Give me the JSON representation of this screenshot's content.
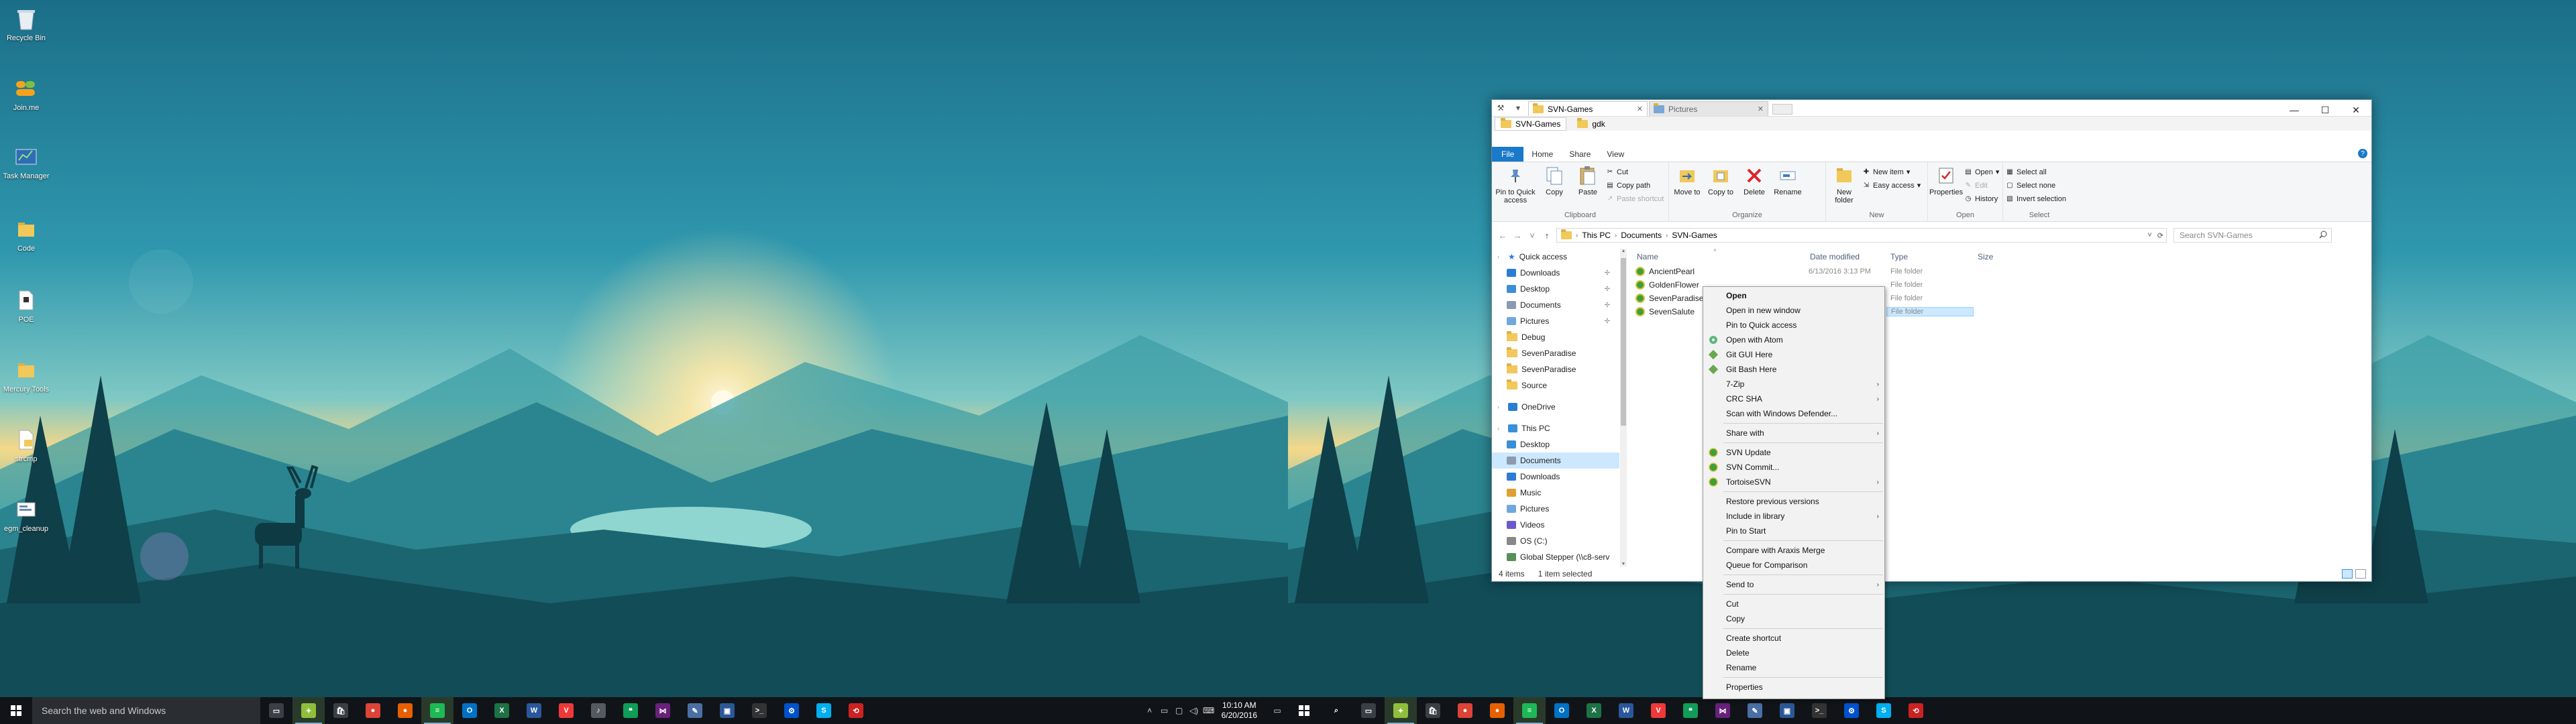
{
  "desktop": {
    "icons": [
      {
        "label": "Recycle Bin",
        "icon": "recycle-bin-icon"
      },
      {
        "label": "Join.me",
        "icon": "joinme-icon"
      },
      {
        "label": "Task Manager",
        "icon": "task-manager-icon"
      },
      {
        "label": "Code",
        "icon": "folder-icon"
      },
      {
        "label": "POE",
        "icon": "document-icon"
      },
      {
        "label": "Mercury Tools",
        "icon": "folder-icon"
      },
      {
        "label": "strcmp",
        "icon": "file-icon"
      },
      {
        "label": "egm_cleanup",
        "icon": "script-icon"
      }
    ]
  },
  "taskbar_left": {
    "search_placeholder": "Search the web and Windows",
    "time": "10:10 AM",
    "date": "6/20/2016",
    "apps": [
      {
        "name": "task-view",
        "color": "#3a3f45",
        "glyph": "▭",
        "active": false
      },
      {
        "name": "git-gui",
        "color": "#8fbf3a",
        "glyph": "✦",
        "active": true
      },
      {
        "name": "store",
        "color": "#3a3f45",
        "glyph": "🛍",
        "active": false
      },
      {
        "name": "chrome",
        "color": "#db4437",
        "glyph": "●",
        "active": false
      },
      {
        "name": "firefox",
        "color": "#e66000",
        "glyph": "●",
        "active": false
      },
      {
        "name": "spotify",
        "color": "#1db954",
        "glyph": "≡",
        "active": true
      },
      {
        "name": "outlook",
        "color": "#0072c6",
        "glyph": "O",
        "active": false
      },
      {
        "name": "excel",
        "color": "#1e7145",
        "glyph": "X",
        "active": false
      },
      {
        "name": "word",
        "color": "#2b579a",
        "glyph": "W",
        "active": false
      },
      {
        "name": "vivaldi",
        "color": "#ef3939",
        "glyph": "V",
        "active": false
      },
      {
        "name": "media",
        "color": "#555a60",
        "glyph": "♪",
        "active": false
      },
      {
        "name": "hangouts",
        "color": "#0f9d58",
        "glyph": "❝",
        "active": false
      },
      {
        "name": "visual-studio",
        "color": "#68217a",
        "glyph": "⋈",
        "active": false
      },
      {
        "name": "tools",
        "color": "#4a6fa5",
        "glyph": "✎",
        "active": false
      },
      {
        "name": "remote",
        "color": "#2b5797",
        "glyph": "▣",
        "active": false
      },
      {
        "name": "terminal",
        "color": "#333",
        "glyph": ">_",
        "active": false
      },
      {
        "name": "sourcetree",
        "color": "#0052cc",
        "glyph": "⚙",
        "active": false
      },
      {
        "name": "skype",
        "color": "#00aff0",
        "glyph": "S",
        "active": false
      },
      {
        "name": "tortoise",
        "color": "#cc2222",
        "glyph": "⟲",
        "active": false
      }
    ]
  },
  "taskbar_right": {
    "apps": [
      {
        "name": "search",
        "color": "#101418",
        "glyph": "⌕",
        "active": false
      },
      {
        "name": "task-view",
        "color": "#3a3f45",
        "glyph": "▭",
        "active": false
      },
      {
        "name": "git-gui",
        "color": "#8fbf3a",
        "glyph": "✦",
        "active": true
      },
      {
        "name": "store",
        "color": "#3a3f45",
        "glyph": "🛍",
        "active": false
      },
      {
        "name": "chrome",
        "color": "#db4437",
        "glyph": "●",
        "active": false
      },
      {
        "name": "firefox",
        "color": "#e66000",
        "glyph": "●",
        "active": false
      },
      {
        "name": "spotify",
        "color": "#1db954",
        "glyph": "≡",
        "active": true
      },
      {
        "name": "outlook",
        "color": "#0072c6",
        "glyph": "O",
        "active": false
      },
      {
        "name": "excel",
        "color": "#1e7145",
        "glyph": "X",
        "active": false
      },
      {
        "name": "word",
        "color": "#2b579a",
        "glyph": "W",
        "active": false
      },
      {
        "name": "vivaldi",
        "color": "#ef3939",
        "glyph": "V",
        "active": false
      },
      {
        "name": "hangouts",
        "color": "#0f9d58",
        "glyph": "❝",
        "active": false
      },
      {
        "name": "visual-studio",
        "color": "#68217a",
        "glyph": "⋈",
        "active": false
      },
      {
        "name": "tools",
        "color": "#4a6fa5",
        "glyph": "✎",
        "active": false
      },
      {
        "name": "remote",
        "color": "#2b5797",
        "glyph": "▣",
        "active": false
      },
      {
        "name": "terminal",
        "color": "#333",
        "glyph": ">_",
        "active": false
      },
      {
        "name": "sourcetree",
        "color": "#0052cc",
        "glyph": "⚙",
        "active": false
      },
      {
        "name": "skype",
        "color": "#00aff0",
        "glyph": "S",
        "active": false
      },
      {
        "name": "tortoise",
        "color": "#cc2222",
        "glyph": "⟲",
        "active": false
      }
    ]
  },
  "explorer": {
    "tabs": [
      {
        "label": "SVN-Games",
        "active": true
      },
      {
        "label": "Pictures",
        "active": false
      }
    ],
    "subtabs": [
      {
        "label": "SVN-Games",
        "active": true
      },
      {
        "label": "gdk",
        "active": false
      }
    ],
    "ribbon_tabs": {
      "file": "File",
      "home": "Home",
      "share": "Share",
      "view": "View"
    },
    "ribbon": {
      "clipboard": {
        "pin": "Pin to Quick access",
        "copy": "Copy",
        "paste": "Paste",
        "cut": "Cut",
        "copy_path": "Copy path",
        "paste_shortcut": "Paste shortcut",
        "group": "Clipboard"
      },
      "organize": {
        "move_to": "Move to",
        "copy_to": "Copy to",
        "delete": "Delete",
        "rename": "Rename",
        "group": "Organize"
      },
      "new": {
        "new_folder": "New folder",
        "new_item": "New item",
        "easy_access": "Easy access",
        "group": "New"
      },
      "open": {
        "properties": "Properties",
        "open": "Open",
        "edit": "Edit",
        "history": "History",
        "group": "Open"
      },
      "select": {
        "select_all": "Select all",
        "select_none": "Select none",
        "invert": "Invert selection",
        "group": "Select"
      }
    },
    "breadcrumb": [
      "This PC",
      "Documents",
      "SVN-Games"
    ],
    "search_placeholder": "Search SVN-Games",
    "nav": [
      {
        "label": "Quick access",
        "type": "star",
        "indent": 0,
        "pinned": false,
        "selected": false
      },
      {
        "label": "Downloads",
        "type": "download",
        "indent": 1,
        "pinned": true,
        "selected": false
      },
      {
        "label": "Desktop",
        "type": "desktop",
        "indent": 1,
        "pinned": true,
        "selected": false
      },
      {
        "label": "Documents",
        "type": "doc",
        "indent": 1,
        "pinned": true,
        "selected": false
      },
      {
        "label": "Pictures",
        "type": "pic",
        "indent": 1,
        "pinned": true,
        "selected": false
      },
      {
        "label": "Debug",
        "type": "folder",
        "indent": 1,
        "pinned": false,
        "selected": false
      },
      {
        "label": "SevenParadise",
        "type": "folder",
        "indent": 1,
        "pinned": false,
        "selected": false
      },
      {
        "label": "SevenParadise",
        "type": "folder",
        "indent": 1,
        "pinned": false,
        "selected": false
      },
      {
        "label": "Source",
        "type": "folder",
        "indent": 1,
        "pinned": false,
        "selected": false
      },
      {
        "label": "",
        "type": "spacer",
        "indent": 0,
        "pinned": false,
        "selected": false
      },
      {
        "label": "OneDrive",
        "type": "cloud",
        "indent": 0,
        "pinned": false,
        "selected": false
      },
      {
        "label": "",
        "type": "spacer",
        "indent": 0,
        "pinned": false,
        "selected": false
      },
      {
        "label": "This PC",
        "type": "pc",
        "indent": 0,
        "pinned": false,
        "selected": false
      },
      {
        "label": "Desktop",
        "type": "desktop",
        "indent": 1,
        "pinned": false,
        "selected": false
      },
      {
        "label": "Documents",
        "type": "doc",
        "indent": 1,
        "pinned": false,
        "selected": true
      },
      {
        "label": "Downloads",
        "type": "download",
        "indent": 1,
        "pinned": false,
        "selected": false
      },
      {
        "label": "Music",
        "type": "music",
        "indent": 1,
        "pinned": false,
        "selected": false
      },
      {
        "label": "Pictures",
        "type": "pic",
        "indent": 1,
        "pinned": false,
        "selected": false
      },
      {
        "label": "Videos",
        "type": "video",
        "indent": 1,
        "pinned": false,
        "selected": false
      },
      {
        "label": "OS (C:)",
        "type": "drive",
        "indent": 1,
        "pinned": false,
        "selected": false
      },
      {
        "label": "Global Stepper (\\\\c8-serv",
        "type": "netdrive",
        "indent": 1,
        "pinned": false,
        "selected": false
      }
    ],
    "columns": {
      "name": "Name",
      "date": "Date modified",
      "type": "Type",
      "size": "Size"
    },
    "files": [
      {
        "name": "AncientPearl",
        "date": "6/13/2016 3:13 PM",
        "type": "File folder",
        "selected": false
      },
      {
        "name": "GoldenFlower",
        "date": "",
        "type": "File folder",
        "selected": false
      },
      {
        "name": "SevenParadise",
        "date": "",
        "type": "File folder",
        "selected": false
      },
      {
        "name": "SevenSalute",
        "date": "",
        "type": "File folder",
        "selected": true
      }
    ],
    "status": {
      "count": "4 items",
      "selected": "1 item selected"
    }
  },
  "context_menu": [
    {
      "label": "Open",
      "bold": true,
      "icon": "",
      "submenu": false
    },
    {
      "label": "Open in new window",
      "bold": false,
      "icon": "",
      "submenu": false
    },
    {
      "label": "Pin to Quick access",
      "bold": false,
      "icon": "",
      "submenu": false
    },
    {
      "label": "Open with Atom",
      "bold": false,
      "icon": "atom",
      "submenu": false
    },
    {
      "label": "Git GUI Here",
      "bold": false,
      "icon": "git",
      "submenu": false
    },
    {
      "label": "Git Bash Here",
      "bold": false,
      "icon": "git",
      "submenu": false
    },
    {
      "label": "7-Zip",
      "bold": false,
      "icon": "",
      "submenu": true
    },
    {
      "label": "CRC SHA",
      "bold": false,
      "icon": "",
      "submenu": true
    },
    {
      "label": "Scan with Windows Defender...",
      "bold": false,
      "icon": "",
      "submenu": false
    },
    {
      "sep": true
    },
    {
      "label": "Share with",
      "bold": false,
      "icon": "",
      "submenu": true
    },
    {
      "sep": true
    },
    {
      "label": "SVN Update",
      "bold": false,
      "icon": "svn",
      "submenu": false
    },
    {
      "label": "SVN Commit...",
      "bold": false,
      "icon": "svn",
      "submenu": false
    },
    {
      "label": "TortoiseSVN",
      "bold": false,
      "icon": "svn",
      "submenu": true
    },
    {
      "sep": true
    },
    {
      "label": "Restore previous versions",
      "bold": false,
      "icon": "",
      "submenu": false
    },
    {
      "label": "Include in library",
      "bold": false,
      "icon": "",
      "submenu": true
    },
    {
      "label": "Pin to Start",
      "bold": false,
      "icon": "",
      "submenu": false
    },
    {
      "sep": true
    },
    {
      "label": "Compare with Araxis Merge",
      "bold": false,
      "icon": "",
      "submenu": false
    },
    {
      "label": "Queue for Comparison",
      "bold": false,
      "icon": "",
      "submenu": false
    },
    {
      "sep": true
    },
    {
      "label": "Send to",
      "bold": false,
      "icon": "",
      "submenu": true
    },
    {
      "sep": true
    },
    {
      "label": "Cut",
      "bold": false,
      "icon": "",
      "submenu": false
    },
    {
      "label": "Copy",
      "bold": false,
      "icon": "",
      "submenu": false
    },
    {
      "sep": true
    },
    {
      "label": "Create shortcut",
      "bold": false,
      "icon": "",
      "submenu": false
    },
    {
      "label": "Delete",
      "bold": false,
      "icon": "",
      "submenu": false
    },
    {
      "label": "Rename",
      "bold": false,
      "icon": "",
      "submenu": false
    },
    {
      "sep": true
    },
    {
      "label": "Properties",
      "bold": false,
      "icon": "",
      "submenu": false
    }
  ]
}
